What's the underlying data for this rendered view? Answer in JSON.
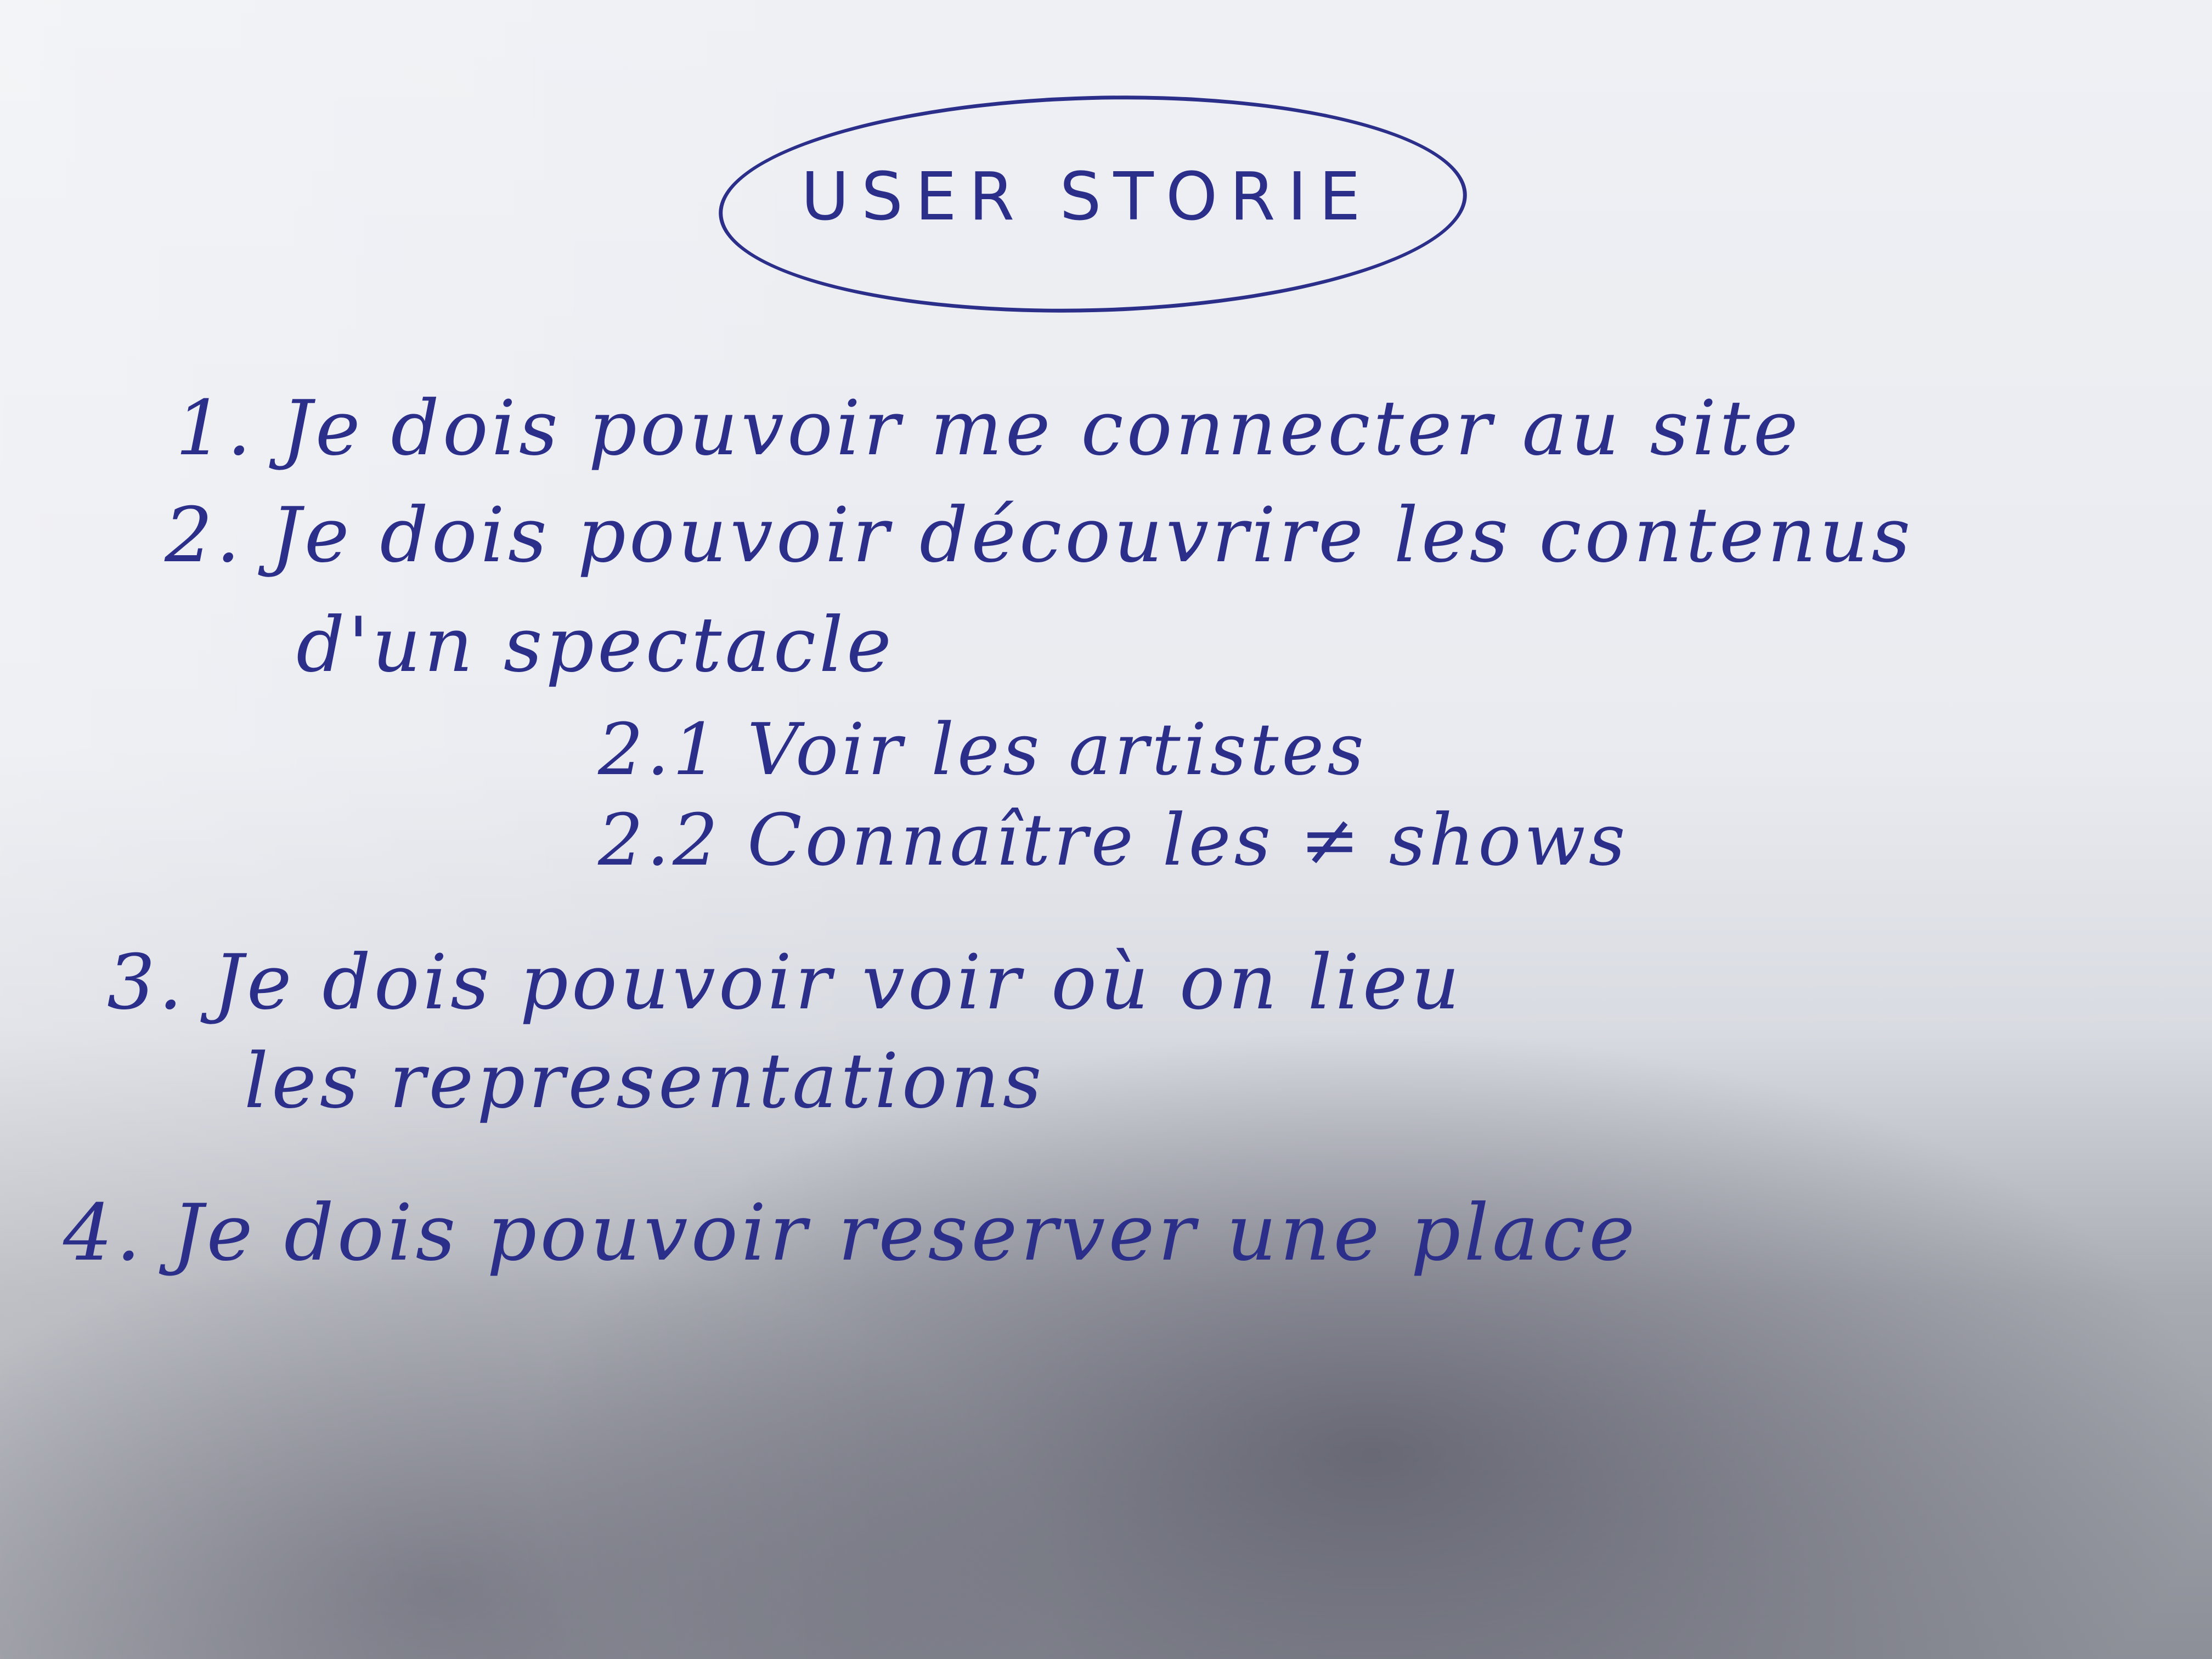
{
  "title": "USER STORIE",
  "items": [
    "1. Je dois pouvoir me connecter au site",
    "2. Je dois pouvoir découvrire les contenus",
    "d'un spectacle",
    "2.1 Voir les artistes",
    "2.2 Connaître les ≠ shows",
    "3. Je dois pouvoir voir où on lieu",
    "les representations",
    "4. Je dois pouvoir reserver une place"
  ],
  "colors": {
    "ink": "#2b2f8a",
    "paper": "#eef0f4"
  }
}
